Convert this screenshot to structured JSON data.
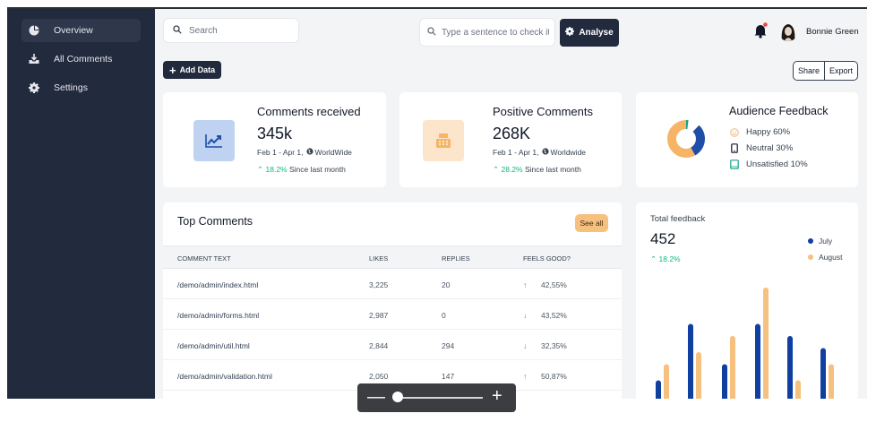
{
  "sidebar": {
    "items": [
      {
        "label": "Overview",
        "icon": "pie-chart-icon",
        "active": true
      },
      {
        "label": "All Comments",
        "icon": "inbox-download-icon",
        "active": false
      },
      {
        "label": "Settings",
        "icon": "gear-icon",
        "active": false
      }
    ]
  },
  "header": {
    "search_placeholder": "Search",
    "sentence_placeholder": "Type a sentence to check it",
    "analyse_label": "Analyse",
    "user_name": "Bonnie Green"
  },
  "toolbar": {
    "add_data_label": "Add Data",
    "share_label": "Share",
    "export_label": "Export"
  },
  "stats": [
    {
      "title": "Comments received",
      "value": "345k",
      "period": "Feb 1 - Apr 1,",
      "region": "WorldWide",
      "change": "18.2%",
      "change_note": "Since last month",
      "icon": "trend-chart-icon"
    },
    {
      "title": "Positive Comments",
      "value": "268K",
      "period": "Feb 1 - Apr 1,",
      "region": "Worldwide",
      "change": "28.2%",
      "change_note": "Since last month",
      "icon": "cash-register-icon"
    }
  ],
  "audience": {
    "title": "Audience Feedback",
    "rows": [
      {
        "label": "Happy 60%",
        "icon": "smile-icon",
        "value": 60,
        "color": "#f6b566"
      },
      {
        "label": "Neutral 30%",
        "icon": "phone-icon",
        "value": 30,
        "color": "#1e4ea8"
      },
      {
        "label": "Unsatisfied 10%",
        "icon": "tablet-icon",
        "value": 10,
        "color": "#14a38b"
      }
    ]
  },
  "top_comments": {
    "title": "Top Comments",
    "see_all_label": "See all",
    "columns": [
      "COMMENT TEXT",
      "LIKES",
      "REPLIES",
      "FEELS GOOD?"
    ],
    "rows": [
      {
        "text": "/demo/admin/index.html",
        "likes": "3,225",
        "replies": "20",
        "trend": "up",
        "feels": "42,55%"
      },
      {
        "text": "/demo/admin/forms.html",
        "likes": "2,987",
        "replies": "0",
        "trend": "down",
        "feels": "43,52%"
      },
      {
        "text": "/demo/admin/util.html",
        "likes": "2,844",
        "replies": "294",
        "trend": "down",
        "feels": "32,35%"
      },
      {
        "text": "/demo/admin/validation.html",
        "likes": "2,050",
        "replies": "147",
        "trend": "up",
        "feels": "50,87%"
      }
    ]
  },
  "feedback": {
    "title": "Total feedback",
    "value": "452",
    "change": "18.2%"
  },
  "chart_data": {
    "type": "bar",
    "series": [
      {
        "name": "July",
        "color": "#0f3fa1",
        "values": [
          2.5,
          9.5,
          4.5,
          9.5,
          8.0,
          6.5
        ]
      },
      {
        "name": "August",
        "color": "#f6c07f",
        "values": [
          4.5,
          6.0,
          8.0,
          14.0,
          2.5,
          4.5
        ]
      }
    ],
    "ylim": [
      0,
      15
    ]
  },
  "zoom": {
    "level": 0.05
  }
}
